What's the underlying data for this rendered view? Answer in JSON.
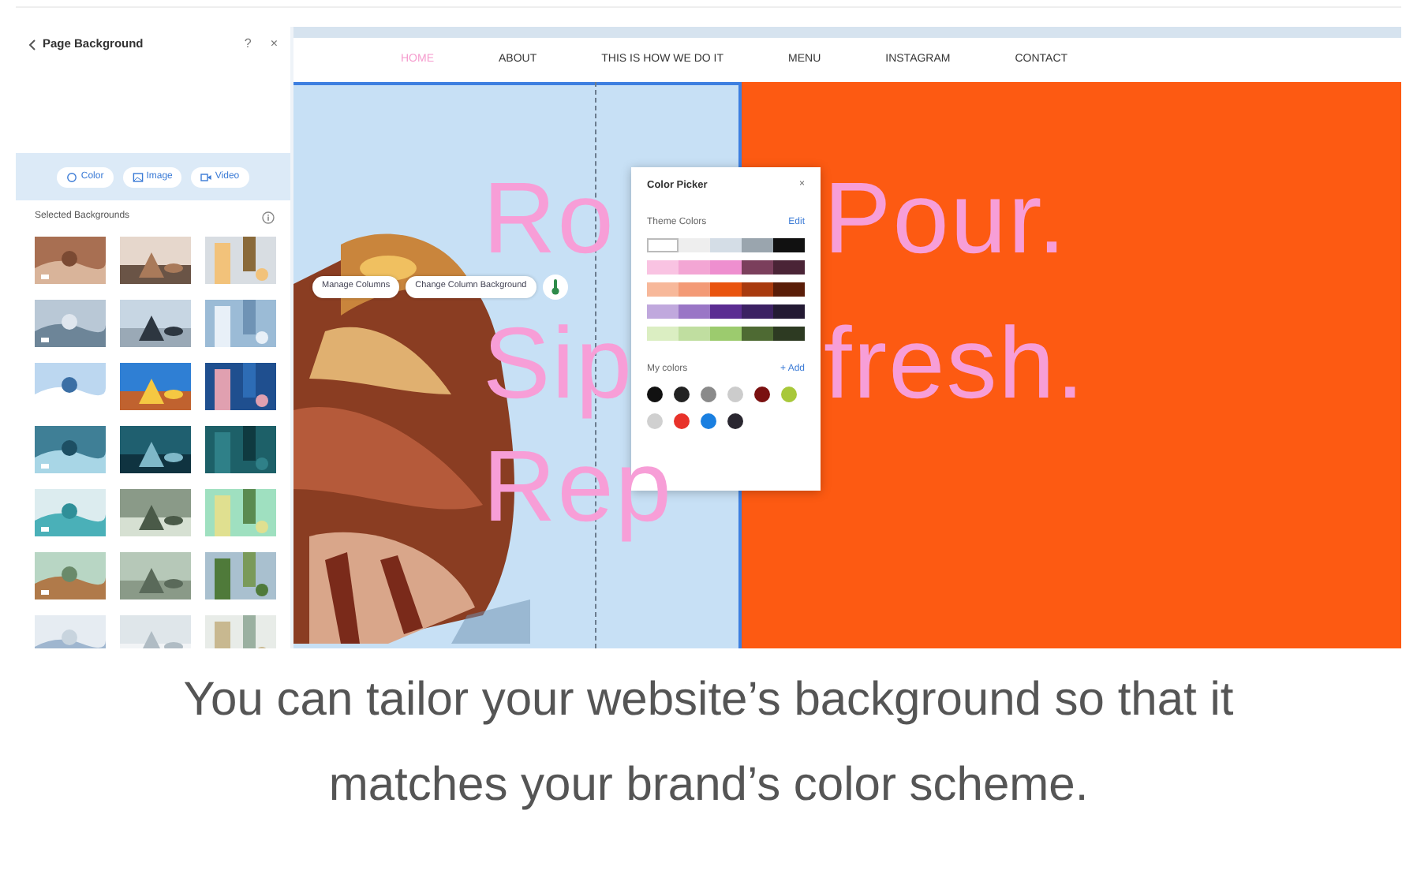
{
  "left_panel": {
    "title": "Page Background",
    "help": "?",
    "close": "×",
    "media_tabs": [
      {
        "label": "Color",
        "selected": false
      },
      {
        "label": "Image",
        "selected": false
      },
      {
        "label": "Video",
        "selected": false
      }
    ],
    "section_title": "Selected Backgrounds"
  },
  "site": {
    "nav": [
      {
        "label": "HOME",
        "selected": true
      },
      {
        "label": "ABOUT",
        "selected": false
      },
      {
        "label": "THIS IS HOW WE DO IT",
        "selected": false
      },
      {
        "label": "MENU",
        "selected": false
      },
      {
        "label": "INSTAGRAM",
        "selected": false
      },
      {
        "label": "CONTACT",
        "selected": false
      }
    ],
    "headline_left": [
      "Ro",
      "Sip",
      "Rep"
    ],
    "headline_right": [
      "Pour.",
      "fresh."
    ],
    "column_toolbar": [
      "Manage Columns",
      "Change Column Background"
    ]
  },
  "color_picker": {
    "title": "Color Picker",
    "close": "×",
    "theme_label": "Theme Colors",
    "edit": "Edit",
    "theme_rows": [
      [
        {
          "color": "#ffffff",
          "selected": true
        },
        {
          "color": "#eeeeee",
          "selected": false
        },
        {
          "color": "#d4dde6",
          "selected": false
        },
        {
          "color": "#9aa5ae",
          "selected": false
        },
        {
          "color": "#111111",
          "selected": false
        }
      ],
      [
        {
          "color": "#f9c3e2",
          "selected": false
        },
        {
          "color": "#f3a6d4",
          "selected": false
        },
        {
          "color": "#ee8fcf",
          "selected": false
        },
        {
          "color": "#7b3f5c",
          "selected": false
        },
        {
          "color": "#4a2436",
          "selected": false
        }
      ],
      [
        {
          "color": "#f7b89a",
          "selected": false
        },
        {
          "color": "#f39a76",
          "selected": false
        },
        {
          "color": "#e9540f",
          "selected": false
        },
        {
          "color": "#a83a0e",
          "selected": false
        },
        {
          "color": "#5a1d08",
          "selected": false
        }
      ],
      [
        {
          "color": "#c0a8dd",
          "selected": false
        },
        {
          "color": "#9a76c6",
          "selected": false
        },
        {
          "color": "#5b2d92",
          "selected": false
        },
        {
          "color": "#3c2163",
          "selected": false
        },
        {
          "color": "#231a33",
          "selected": false
        }
      ],
      [
        {
          "color": "#dbeec2",
          "selected": false
        },
        {
          "color": "#c0dea0",
          "selected": false
        },
        {
          "color": "#9ccb6e",
          "selected": false
        },
        {
          "color": "#4e6a33",
          "selected": false
        },
        {
          "color": "#2d3a22",
          "selected": false
        }
      ]
    ],
    "my_colors_label": "My colors",
    "add": "+ Add",
    "my_colors": [
      {
        "color": "#111111"
      },
      {
        "color": "#222222"
      },
      {
        "color": "#8a8a8a"
      },
      {
        "color": "#cccccc"
      },
      {
        "color": "#7a1010"
      },
      {
        "color": "#a8c83a"
      },
      {
        "color": "#d0d0d0"
      },
      {
        "color": "#e8322a"
      },
      {
        "color": "#1a7fe0"
      },
      {
        "color": "#2a2730"
      }
    ]
  },
  "caption": "You can tailor your website’s background so that it matches your brand’s color scheme."
}
